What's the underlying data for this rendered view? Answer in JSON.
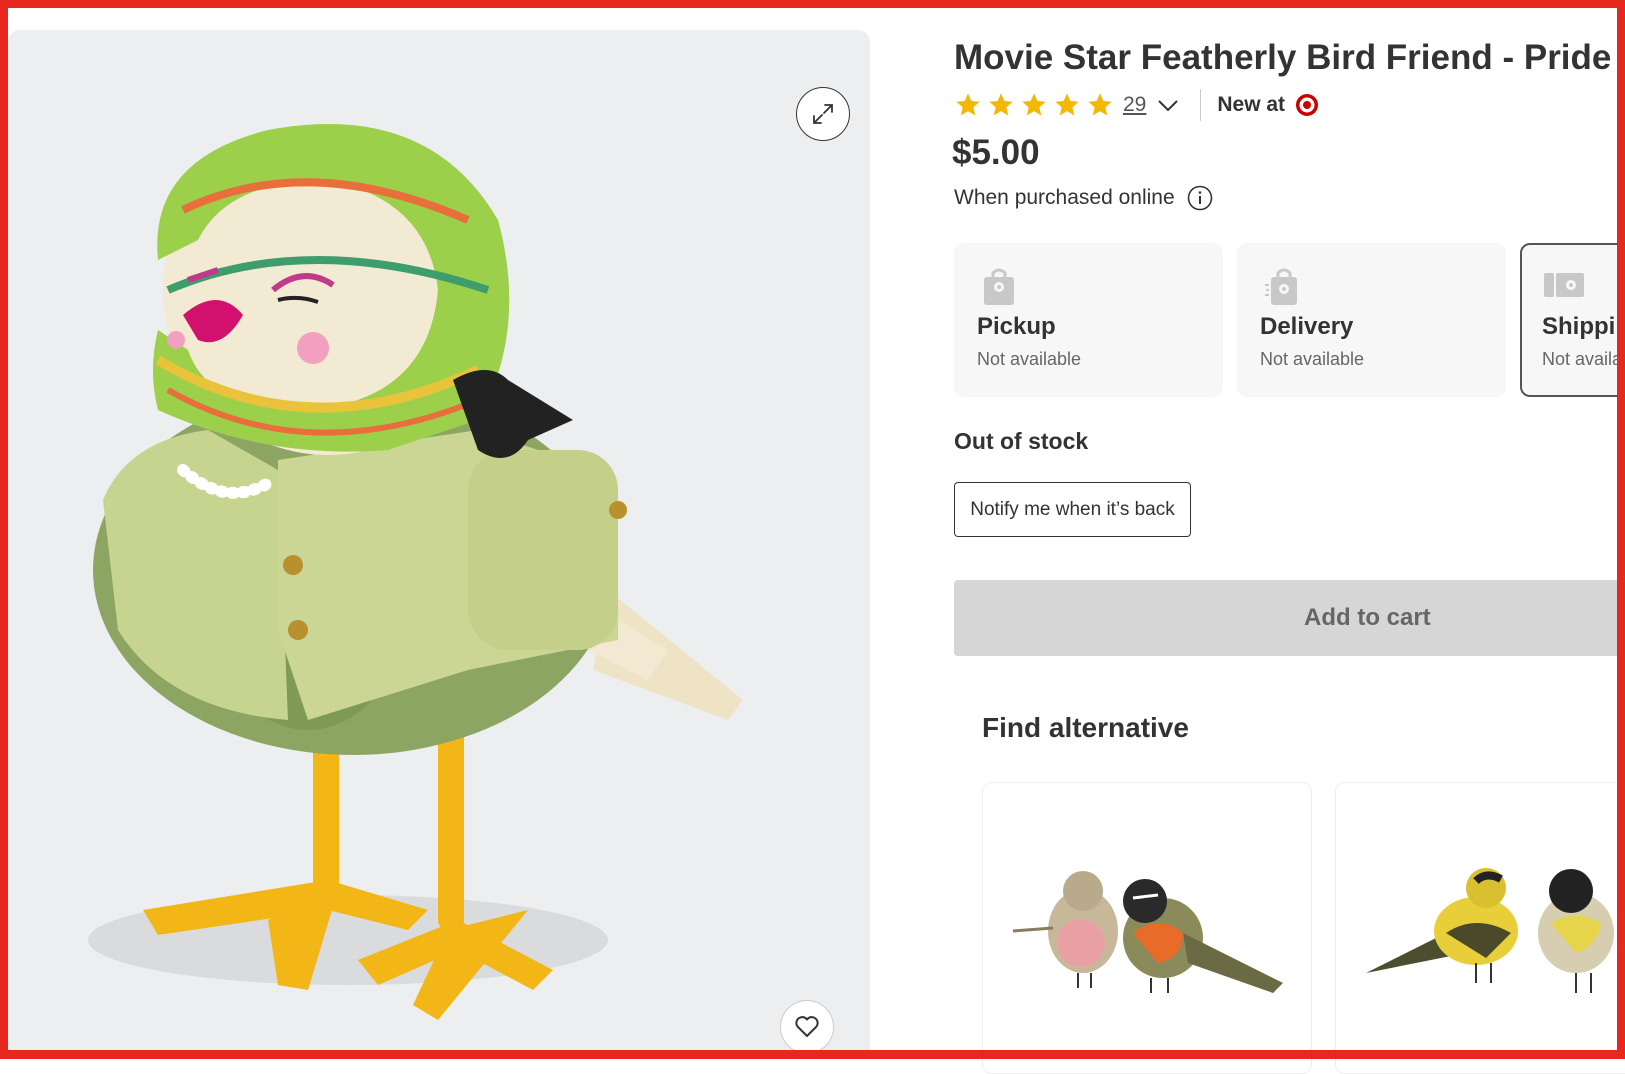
{
  "product": {
    "title": "Movie Star Featherly Bird Friend - Pride",
    "rating": 5,
    "review_count": "29",
    "new_at_label": "New at",
    "price": "$5.00",
    "price_note": "When purchased online"
  },
  "fulfillment": [
    {
      "title": "Pickup",
      "status": "Not available",
      "icon": "store-bag-icon"
    },
    {
      "title": "Delivery",
      "status": "Not available",
      "icon": "delivery-bag-icon"
    },
    {
      "title": "Shipping",
      "status": "Not available",
      "icon": "shipping-truck-icon"
    }
  ],
  "stock": {
    "label": "Out of stock",
    "notify_label": "Notify me when it’s back"
  },
  "cart": {
    "add_label": "Add to cart"
  },
  "alternatives": {
    "title": "Find alternative",
    "items": [
      {
        "image": "two-birds-robin-image"
      },
      {
        "image": "two-birds-yellow-image"
      }
    ]
  },
  "colors": {
    "brand": "#cc0000",
    "star": "#f5b800",
    "frame": "#e8281c"
  }
}
